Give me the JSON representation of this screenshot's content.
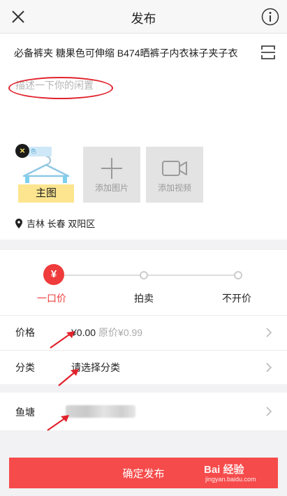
{
  "header": {
    "title": "发布",
    "close_icon": "close-icon",
    "info_icon": "info-icon"
  },
  "item": {
    "title": "必备裤夹 糖果色可伸缩 B474晒裤子内衣袜子夹子衣",
    "description": {
      "value": "",
      "placeholder": "描述一下你的闲置"
    }
  },
  "media": {
    "main_photo_badge": "主图",
    "main_photo_remove": "×",
    "add_photo_label": "添加图片",
    "add_video_label": "添加视频"
  },
  "location": {
    "text": "吉林 长春 双阳区"
  },
  "pricing": {
    "currency_symbol": "¥",
    "options": [
      "一口价",
      "拍卖",
      "不开价"
    ],
    "selected": "一口价",
    "price_label": "价格",
    "price_value": "¥0.00",
    "original_price": "原价¥0.99",
    "category_label": "分类",
    "category_value": "请选择分类"
  },
  "pond": {
    "label": "鱼塘"
  },
  "publish_button": "确定发布",
  "watermark": {
    "main": "Bai 经验",
    "url": "jingyan.baidu.com"
  },
  "colors": {
    "accent": "#f64b4b",
    "annotation": "#e1222c",
    "badge": "#fde58f"
  }
}
